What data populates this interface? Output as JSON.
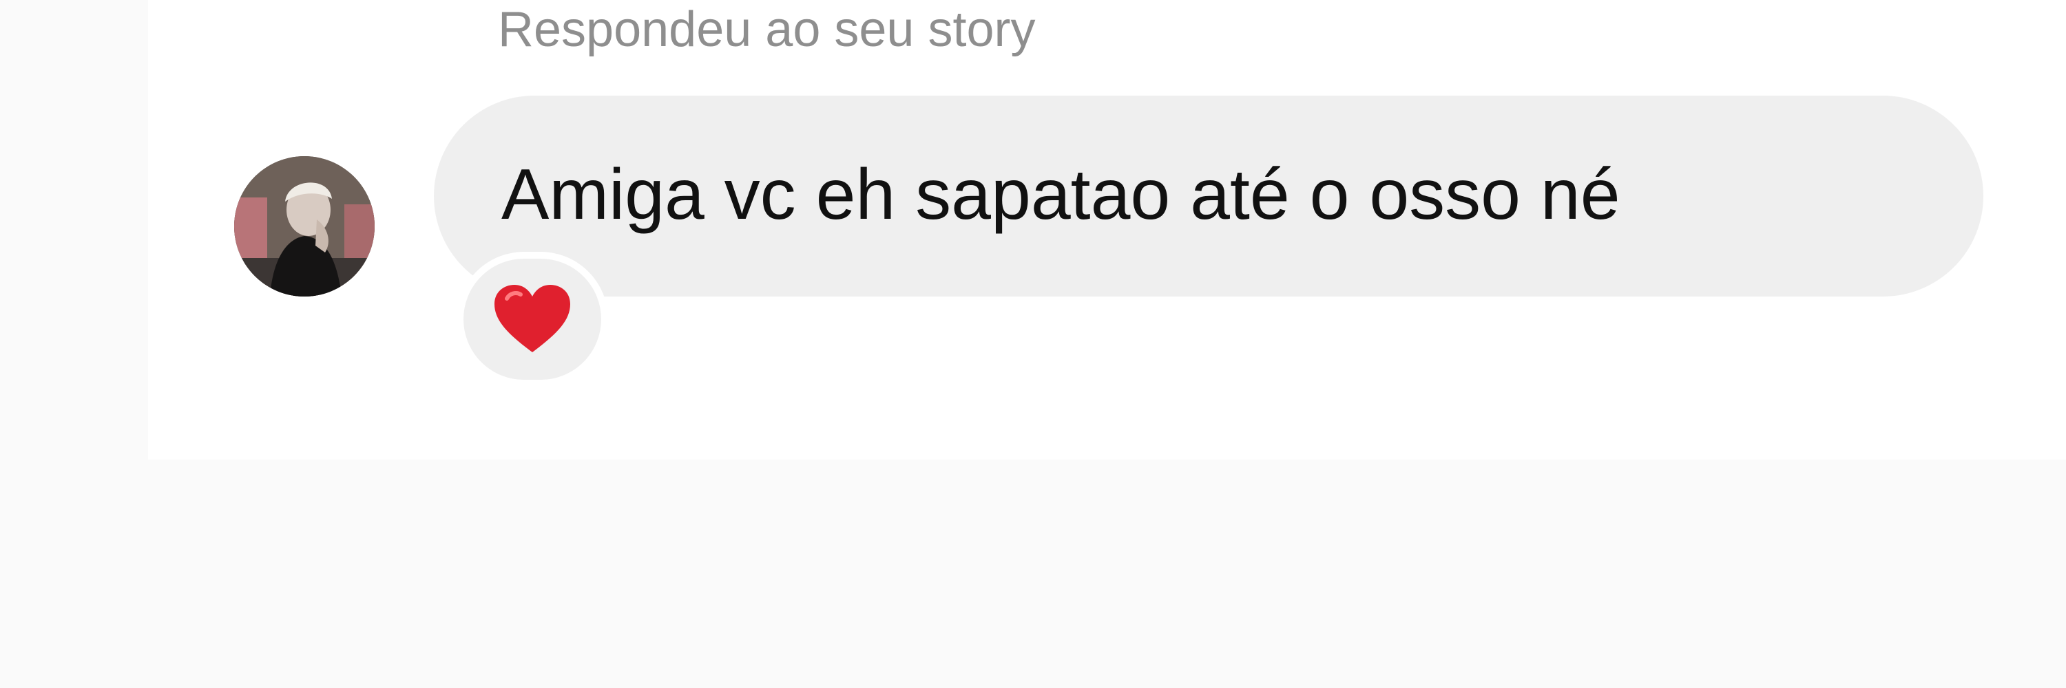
{
  "conversation": {
    "reply_context": "Respondeu ao seu story",
    "message": {
      "text": "Amiga vc eh sapatao até o osso né",
      "reaction": {
        "icon": "red-heart-icon",
        "color": "#e0202e"
      }
    },
    "colors": {
      "bubble": "#efefef",
      "reply_context_text": "#8e8e8e",
      "message_text": "#111111",
      "page_background": "#fafafa",
      "panel_background": "#ffffff"
    }
  }
}
